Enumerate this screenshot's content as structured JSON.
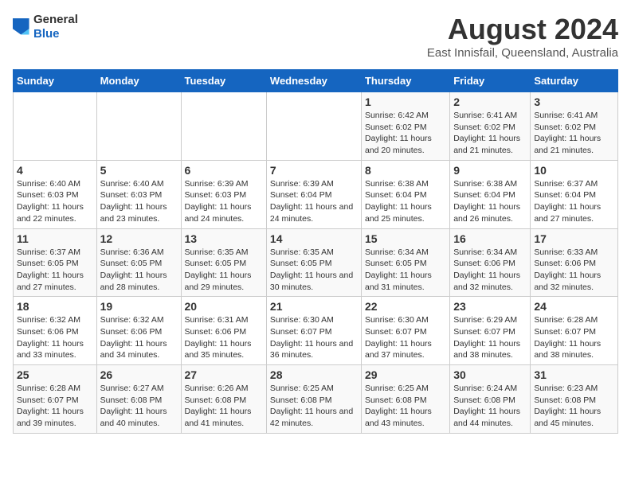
{
  "logo": {
    "general": "General",
    "blue": "Blue"
  },
  "title": "August 2024",
  "subtitle": "East Innisfail, Queensland, Australia",
  "days_of_week": [
    "Sunday",
    "Monday",
    "Tuesday",
    "Wednesday",
    "Thursday",
    "Friday",
    "Saturday"
  ],
  "weeks": [
    [
      {
        "day": "",
        "sunrise": "",
        "sunset": "",
        "daylight": ""
      },
      {
        "day": "",
        "sunrise": "",
        "sunset": "",
        "daylight": ""
      },
      {
        "day": "",
        "sunrise": "",
        "sunset": "",
        "daylight": ""
      },
      {
        "day": "",
        "sunrise": "",
        "sunset": "",
        "daylight": ""
      },
      {
        "day": "1",
        "sunrise": "Sunrise: 6:42 AM",
        "sunset": "Sunset: 6:02 PM",
        "daylight": "Daylight: 11 hours and 20 minutes."
      },
      {
        "day": "2",
        "sunrise": "Sunrise: 6:41 AM",
        "sunset": "Sunset: 6:02 PM",
        "daylight": "Daylight: 11 hours and 21 minutes."
      },
      {
        "day": "3",
        "sunrise": "Sunrise: 6:41 AM",
        "sunset": "Sunset: 6:02 PM",
        "daylight": "Daylight: 11 hours and 21 minutes."
      }
    ],
    [
      {
        "day": "4",
        "sunrise": "Sunrise: 6:40 AM",
        "sunset": "Sunset: 6:03 PM",
        "daylight": "Daylight: 11 hours and 22 minutes."
      },
      {
        "day": "5",
        "sunrise": "Sunrise: 6:40 AM",
        "sunset": "Sunset: 6:03 PM",
        "daylight": "Daylight: 11 hours and 23 minutes."
      },
      {
        "day": "6",
        "sunrise": "Sunrise: 6:39 AM",
        "sunset": "Sunset: 6:03 PM",
        "daylight": "Daylight: 11 hours and 24 minutes."
      },
      {
        "day": "7",
        "sunrise": "Sunrise: 6:39 AM",
        "sunset": "Sunset: 6:04 PM",
        "daylight": "Daylight: 11 hours and 24 minutes."
      },
      {
        "day": "8",
        "sunrise": "Sunrise: 6:38 AM",
        "sunset": "Sunset: 6:04 PM",
        "daylight": "Daylight: 11 hours and 25 minutes."
      },
      {
        "day": "9",
        "sunrise": "Sunrise: 6:38 AM",
        "sunset": "Sunset: 6:04 PM",
        "daylight": "Daylight: 11 hours and 26 minutes."
      },
      {
        "day": "10",
        "sunrise": "Sunrise: 6:37 AM",
        "sunset": "Sunset: 6:04 PM",
        "daylight": "Daylight: 11 hours and 27 minutes."
      }
    ],
    [
      {
        "day": "11",
        "sunrise": "Sunrise: 6:37 AM",
        "sunset": "Sunset: 6:05 PM",
        "daylight": "Daylight: 11 hours and 27 minutes."
      },
      {
        "day": "12",
        "sunrise": "Sunrise: 6:36 AM",
        "sunset": "Sunset: 6:05 PM",
        "daylight": "Daylight: 11 hours and 28 minutes."
      },
      {
        "day": "13",
        "sunrise": "Sunrise: 6:35 AM",
        "sunset": "Sunset: 6:05 PM",
        "daylight": "Daylight: 11 hours and 29 minutes."
      },
      {
        "day": "14",
        "sunrise": "Sunrise: 6:35 AM",
        "sunset": "Sunset: 6:05 PM",
        "daylight": "Daylight: 11 hours and 30 minutes."
      },
      {
        "day": "15",
        "sunrise": "Sunrise: 6:34 AM",
        "sunset": "Sunset: 6:05 PM",
        "daylight": "Daylight: 11 hours and 31 minutes."
      },
      {
        "day": "16",
        "sunrise": "Sunrise: 6:34 AM",
        "sunset": "Sunset: 6:06 PM",
        "daylight": "Daylight: 11 hours and 32 minutes."
      },
      {
        "day": "17",
        "sunrise": "Sunrise: 6:33 AM",
        "sunset": "Sunset: 6:06 PM",
        "daylight": "Daylight: 11 hours and 32 minutes."
      }
    ],
    [
      {
        "day": "18",
        "sunrise": "Sunrise: 6:32 AM",
        "sunset": "Sunset: 6:06 PM",
        "daylight": "Daylight: 11 hours and 33 minutes."
      },
      {
        "day": "19",
        "sunrise": "Sunrise: 6:32 AM",
        "sunset": "Sunset: 6:06 PM",
        "daylight": "Daylight: 11 hours and 34 minutes."
      },
      {
        "day": "20",
        "sunrise": "Sunrise: 6:31 AM",
        "sunset": "Sunset: 6:06 PM",
        "daylight": "Daylight: 11 hours and 35 minutes."
      },
      {
        "day": "21",
        "sunrise": "Sunrise: 6:30 AM",
        "sunset": "Sunset: 6:07 PM",
        "daylight": "Daylight: 11 hours and 36 minutes."
      },
      {
        "day": "22",
        "sunrise": "Sunrise: 6:30 AM",
        "sunset": "Sunset: 6:07 PM",
        "daylight": "Daylight: 11 hours and 37 minutes."
      },
      {
        "day": "23",
        "sunrise": "Sunrise: 6:29 AM",
        "sunset": "Sunset: 6:07 PM",
        "daylight": "Daylight: 11 hours and 38 minutes."
      },
      {
        "day": "24",
        "sunrise": "Sunrise: 6:28 AM",
        "sunset": "Sunset: 6:07 PM",
        "daylight": "Daylight: 11 hours and 38 minutes."
      }
    ],
    [
      {
        "day": "25",
        "sunrise": "Sunrise: 6:28 AM",
        "sunset": "Sunset: 6:07 PM",
        "daylight": "Daylight: 11 hours and 39 minutes."
      },
      {
        "day": "26",
        "sunrise": "Sunrise: 6:27 AM",
        "sunset": "Sunset: 6:08 PM",
        "daylight": "Daylight: 11 hours and 40 minutes."
      },
      {
        "day": "27",
        "sunrise": "Sunrise: 6:26 AM",
        "sunset": "Sunset: 6:08 PM",
        "daylight": "Daylight: 11 hours and 41 minutes."
      },
      {
        "day": "28",
        "sunrise": "Sunrise: 6:25 AM",
        "sunset": "Sunset: 6:08 PM",
        "daylight": "Daylight: 11 hours and 42 minutes."
      },
      {
        "day": "29",
        "sunrise": "Sunrise: 6:25 AM",
        "sunset": "Sunset: 6:08 PM",
        "daylight": "Daylight: 11 hours and 43 minutes."
      },
      {
        "day": "30",
        "sunrise": "Sunrise: 6:24 AM",
        "sunset": "Sunset: 6:08 PM",
        "daylight": "Daylight: 11 hours and 44 minutes."
      },
      {
        "day": "31",
        "sunrise": "Sunrise: 6:23 AM",
        "sunset": "Sunset: 6:08 PM",
        "daylight": "Daylight: 11 hours and 45 minutes."
      }
    ]
  ]
}
